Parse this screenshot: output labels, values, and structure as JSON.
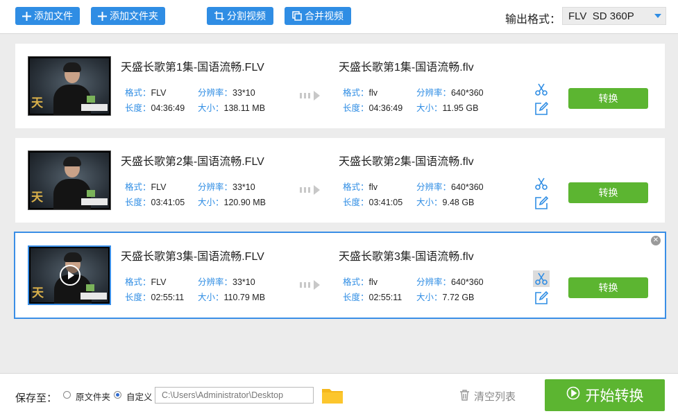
{
  "toolbar": {
    "add_file": "添加文件",
    "add_folder": "添加文件夹",
    "split_video": "分割视频",
    "merge_video": "合并视频",
    "output_format_label": "输出格式：",
    "output_format_value": "FLV  SD 360P"
  },
  "items": [
    {
      "src_title": "天盛长歌第1集-国语流畅.FLV",
      "src_format_key": "格式：",
      "src_format": "FLV",
      "src_res_key": "分辨率：",
      "src_res": "33*10",
      "src_len_key": "长度：",
      "src_len": "04:36:49",
      "src_size_key": "大小：",
      "src_size": "138.11 MB",
      "dst_title": "天盛长歌第1集-国语流畅.flv",
      "dst_format_key": "格式：",
      "dst_format": "flv",
      "dst_res_key": "分辨率：",
      "dst_res": "640*360",
      "dst_len_key": "长度：",
      "dst_len": "04:36:49",
      "dst_size_key": "大小：",
      "dst_size": "11.95 GB",
      "convert": "转换"
    },
    {
      "src_title": "天盛长歌第2集-国语流畅.FLV",
      "src_format_key": "格式：",
      "src_format": "FLV",
      "src_res_key": "分辨率：",
      "src_res": "33*10",
      "src_len_key": "长度：",
      "src_len": "03:41:05",
      "src_size_key": "大小：",
      "src_size": "120.90 MB",
      "dst_title": "天盛长歌第2集-国语流畅.flv",
      "dst_format_key": "格式：",
      "dst_format": "flv",
      "dst_res_key": "分辨率：",
      "dst_res": "640*360",
      "dst_len_key": "长度：",
      "dst_len": "03:41:05",
      "dst_size_key": "大小：",
      "dst_size": "9.48 GB",
      "convert": "转换"
    },
    {
      "src_title": "天盛长歌第3集-国语流畅.FLV",
      "src_format_key": "格式：",
      "src_format": "FLV",
      "src_res_key": "分辨率：",
      "src_res": "33*10",
      "src_len_key": "长度：",
      "src_len": "02:55:11",
      "src_size_key": "大小：",
      "src_size": "110.79 MB",
      "dst_title": "天盛长歌第3集-国语流畅.flv",
      "dst_format_key": "格式：",
      "dst_format": "flv",
      "dst_res_key": "分辨率：",
      "dst_res": "640*360",
      "dst_len_key": "长度：",
      "dst_len": "02:55:11",
      "dst_size_key": "大小：",
      "dst_size": "7.72 GB",
      "convert": "转换"
    }
  ],
  "bottom": {
    "save_to": "保存至：",
    "original_folder": "原文件夹",
    "custom": "自定义",
    "path": "C:\\Users\\Administrator\\Desktop",
    "clear_list": "清空列表",
    "start_convert": "开始转换"
  },
  "colors": {
    "blue": "#2f8de4",
    "green": "#5cb531",
    "list_bg": "#ececec"
  }
}
